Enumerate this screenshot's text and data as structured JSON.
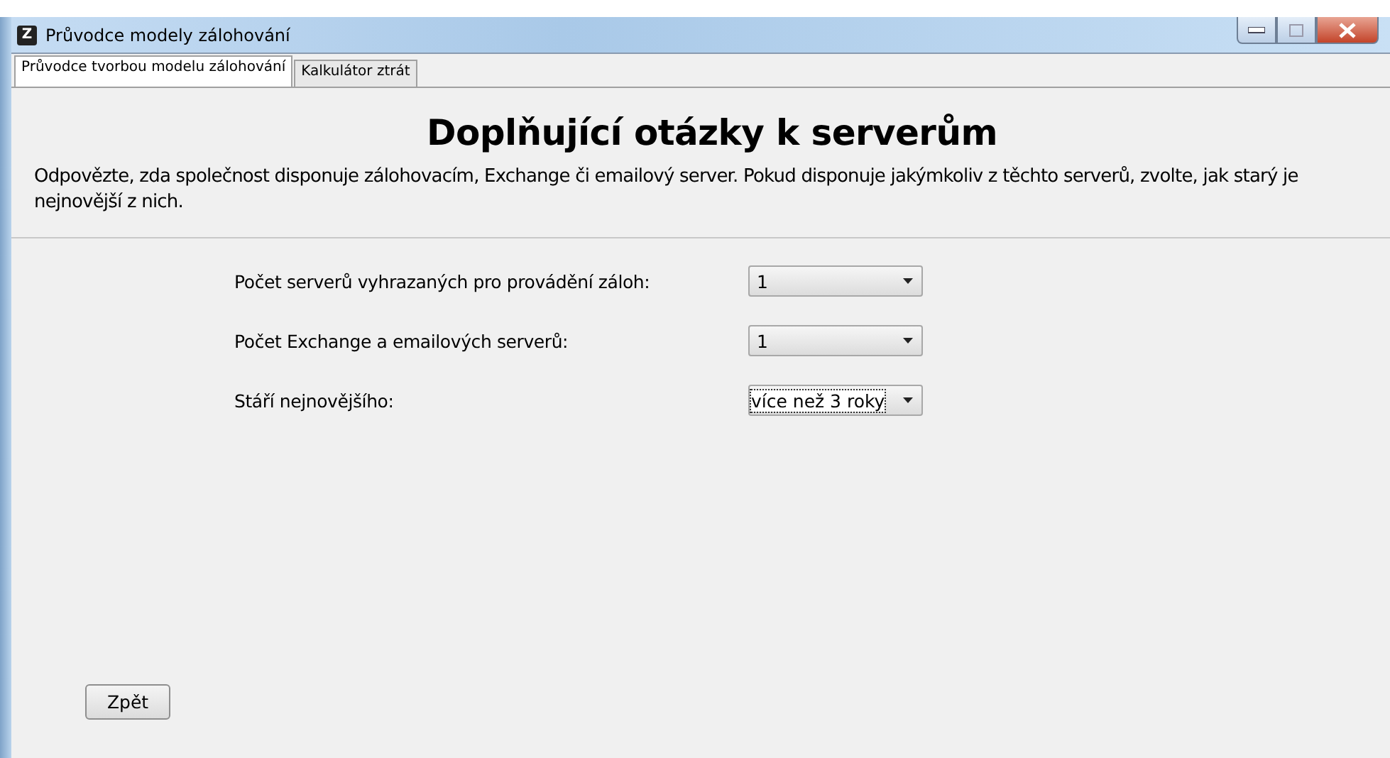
{
  "window": {
    "title": "Průvodce modely zálohování",
    "icon_letter": "Z"
  },
  "tabs": [
    {
      "label": "Průvodce tvorbou modelu zálohování",
      "selected": true
    },
    {
      "label": "Kalkulátor ztrát",
      "selected": false
    }
  ],
  "heading": "Doplňující otázky k serverům",
  "description": "Odpovězte, zda společnost disponuje zálohovacím, Exchange či emailový server. Pokud disponuje jakýmkoliv z těchto serverů, zvolte, jak starý je nejnovější z nich.",
  "fields": [
    {
      "label": "Počet serverů vyhrazaných pro provádění záloh:",
      "value": "1",
      "focused": false
    },
    {
      "label": "Počet Exchange a emailových serverů:",
      "value": "1",
      "focused": false
    },
    {
      "label": "Stáří nejnovějšího:",
      "value": "více než 3 roky",
      "focused": true
    }
  ],
  "buttons": [
    "Zpět"
  ]
}
